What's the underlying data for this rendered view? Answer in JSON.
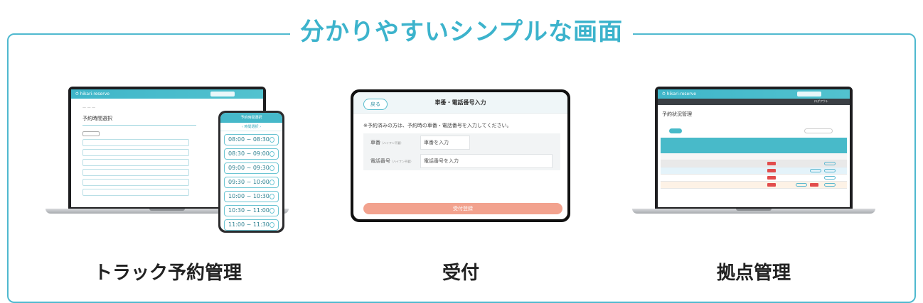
{
  "section": {
    "title": "分かりやすいシンプルな画面"
  },
  "colors": {
    "accent": "#3cb3cc",
    "submit": "#f2a28e",
    "alert": "#e24c4c"
  },
  "features": [
    {
      "caption": "トラック予約管理"
    },
    {
      "caption": "受付"
    },
    {
      "caption": "拠点管理"
    }
  ],
  "truck_screen": {
    "logo": "⏱ hikari-reserve",
    "page_title": "予約時間選択",
    "phone_title": "予約時間選択",
    "phone_date": "‹ 時間選択 ›",
    "phone_slots": [
      "08:00 ~ 08:30",
      "08:30 ~ 09:00",
      "09:00 ~ 09:30",
      "09:30 ~ 10:00",
      "10:00 ~ 10:30",
      "10:30 ~ 11:00",
      "11:00 ~ 11:30"
    ]
  },
  "reception_screen": {
    "back_label": "戻る",
    "title": "車番・電話番号入力",
    "note": "※予約済みの方は、予約時の車番・電話番号を入力してください。",
    "fields": [
      {
        "label": "車番",
        "hint": "（ハイフン不要）",
        "placeholder": "車番を入力"
      },
      {
        "label": "電話番号",
        "hint": "（ハイフン不要）",
        "placeholder": "電話番号を入力"
      }
    ],
    "submit_label": "受付登録"
  },
  "site_screen": {
    "logo": "⏱ hikari-reserve",
    "page_title": "予約状況管理",
    "nav_right": "ログアウト"
  }
}
